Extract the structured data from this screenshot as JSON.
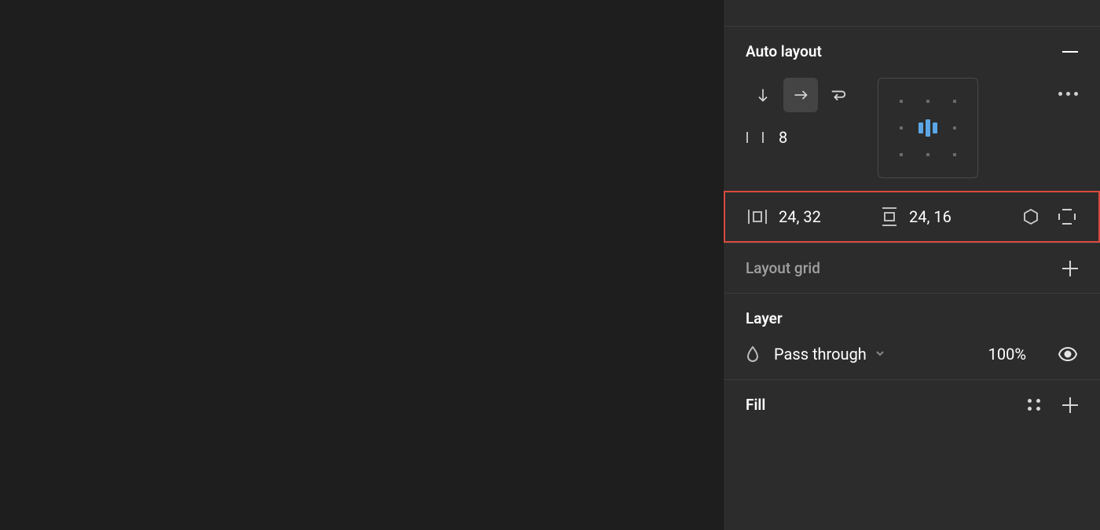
{
  "sections": {
    "auto_layout": {
      "title": "Auto layout",
      "gap_value": "8",
      "padding_horizontal": "24, 32",
      "padding_vertical": "24, 16"
    },
    "layout_grid": {
      "title": "Layout grid"
    },
    "layer": {
      "title": "Layer",
      "blend_mode": "Pass through",
      "opacity": "100%"
    },
    "fill": {
      "title": "Fill"
    }
  }
}
